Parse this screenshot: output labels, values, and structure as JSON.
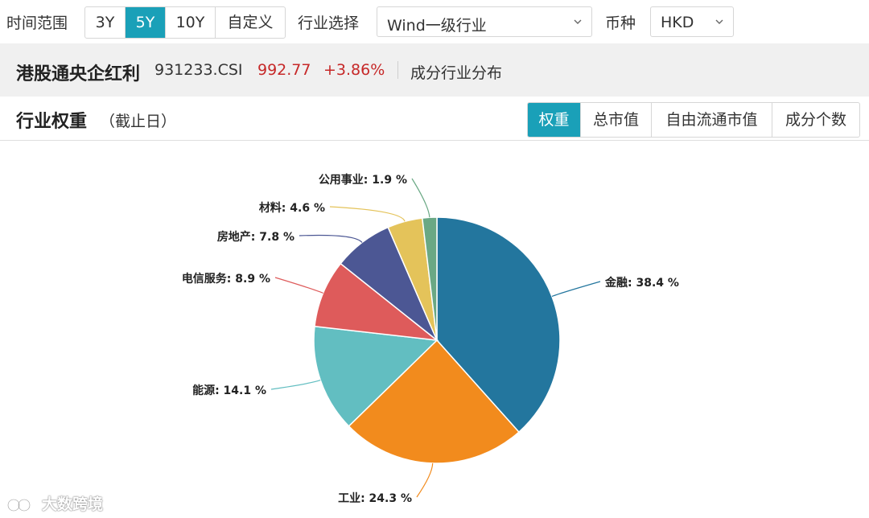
{
  "filters": {
    "time_range_label": "时间范围",
    "time_options": [
      "3Y",
      "5Y",
      "10Y",
      "自定义"
    ],
    "time_selected": "5Y",
    "industry_label": "行业选择",
    "industry_value": "Wind一级行业",
    "currency_label": "币种",
    "currency_value": "HKD"
  },
  "index": {
    "name": "港股通央企红利",
    "code": "931233.CSI",
    "price": "992.77",
    "change": "+3.86%",
    "link": "成分行业分布"
  },
  "panel": {
    "title": "行业权重",
    "subtitle": "（截止日）",
    "tabs": [
      "权重",
      "总市值",
      "自由流通市值",
      "成分个数"
    ],
    "active_tab": "权重"
  },
  "chart_data": {
    "type": "pie",
    "categories": [
      "金融",
      "工业",
      "能源",
      "电信服务",
      "房地产",
      "材料",
      "公用事业"
    ],
    "values": [
      38.4,
      24.3,
      14.1,
      8.9,
      7.8,
      4.6,
      1.9
    ],
    "labels": [
      "金融: 38.4 %",
      "工业: 24.3 %",
      "能源: 14.1 %",
      "电信服务: 8.9 %",
      "房地产: 7.8 %",
      "材料: 4.6 %",
      "公用事业: 1.9 %"
    ],
    "colors": [
      "#23769e",
      "#f28b1d",
      "#62bec1",
      "#de5b5b",
      "#4c5794",
      "#e4c35a",
      "#6aa884"
    ]
  },
  "watermark": {
    "text": "大数跨境"
  }
}
